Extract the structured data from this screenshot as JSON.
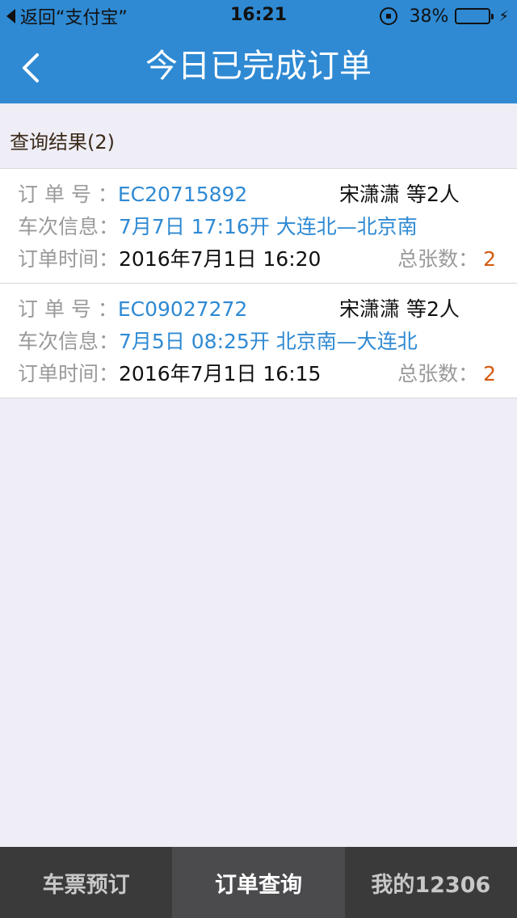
{
  "status_bar": {
    "back_app": "返回“支付宝”",
    "time": "16:21",
    "battery_pct": "38%",
    "battery_level": 0.38
  },
  "nav": {
    "title": "今日已完成订单"
  },
  "result": {
    "header": "查询结果(2)"
  },
  "labels": {
    "order_no": "订 单 号 ：",
    "train_info": "车次信息：",
    "order_time": "订单时间：",
    "ticket_count": "总张数："
  },
  "orders": [
    {
      "order_no": "EC20715892",
      "passengers": "宋潇潇 等2人",
      "train_info": "7月7日 17:16开 大连北—北京南",
      "order_time": "2016年7月1日 16:20",
      "ticket_count": "2"
    },
    {
      "order_no": "EC09027272",
      "passengers": "宋潇潇 等2人",
      "train_info": "7月5日 08:25开 北京南—大连北",
      "order_time": "2016年7月1日 16:15",
      "ticket_count": "2"
    }
  ],
  "tabbar": {
    "tabs": [
      {
        "label": "车票预订"
      },
      {
        "label": "订单查询"
      },
      {
        "label": "我的12306"
      }
    ]
  },
  "colors": {
    "brand_blue": "#2f8ad3",
    "count_orange": "#d35a10",
    "background": "#efeef6",
    "tabbar": "#3a3a3a"
  }
}
